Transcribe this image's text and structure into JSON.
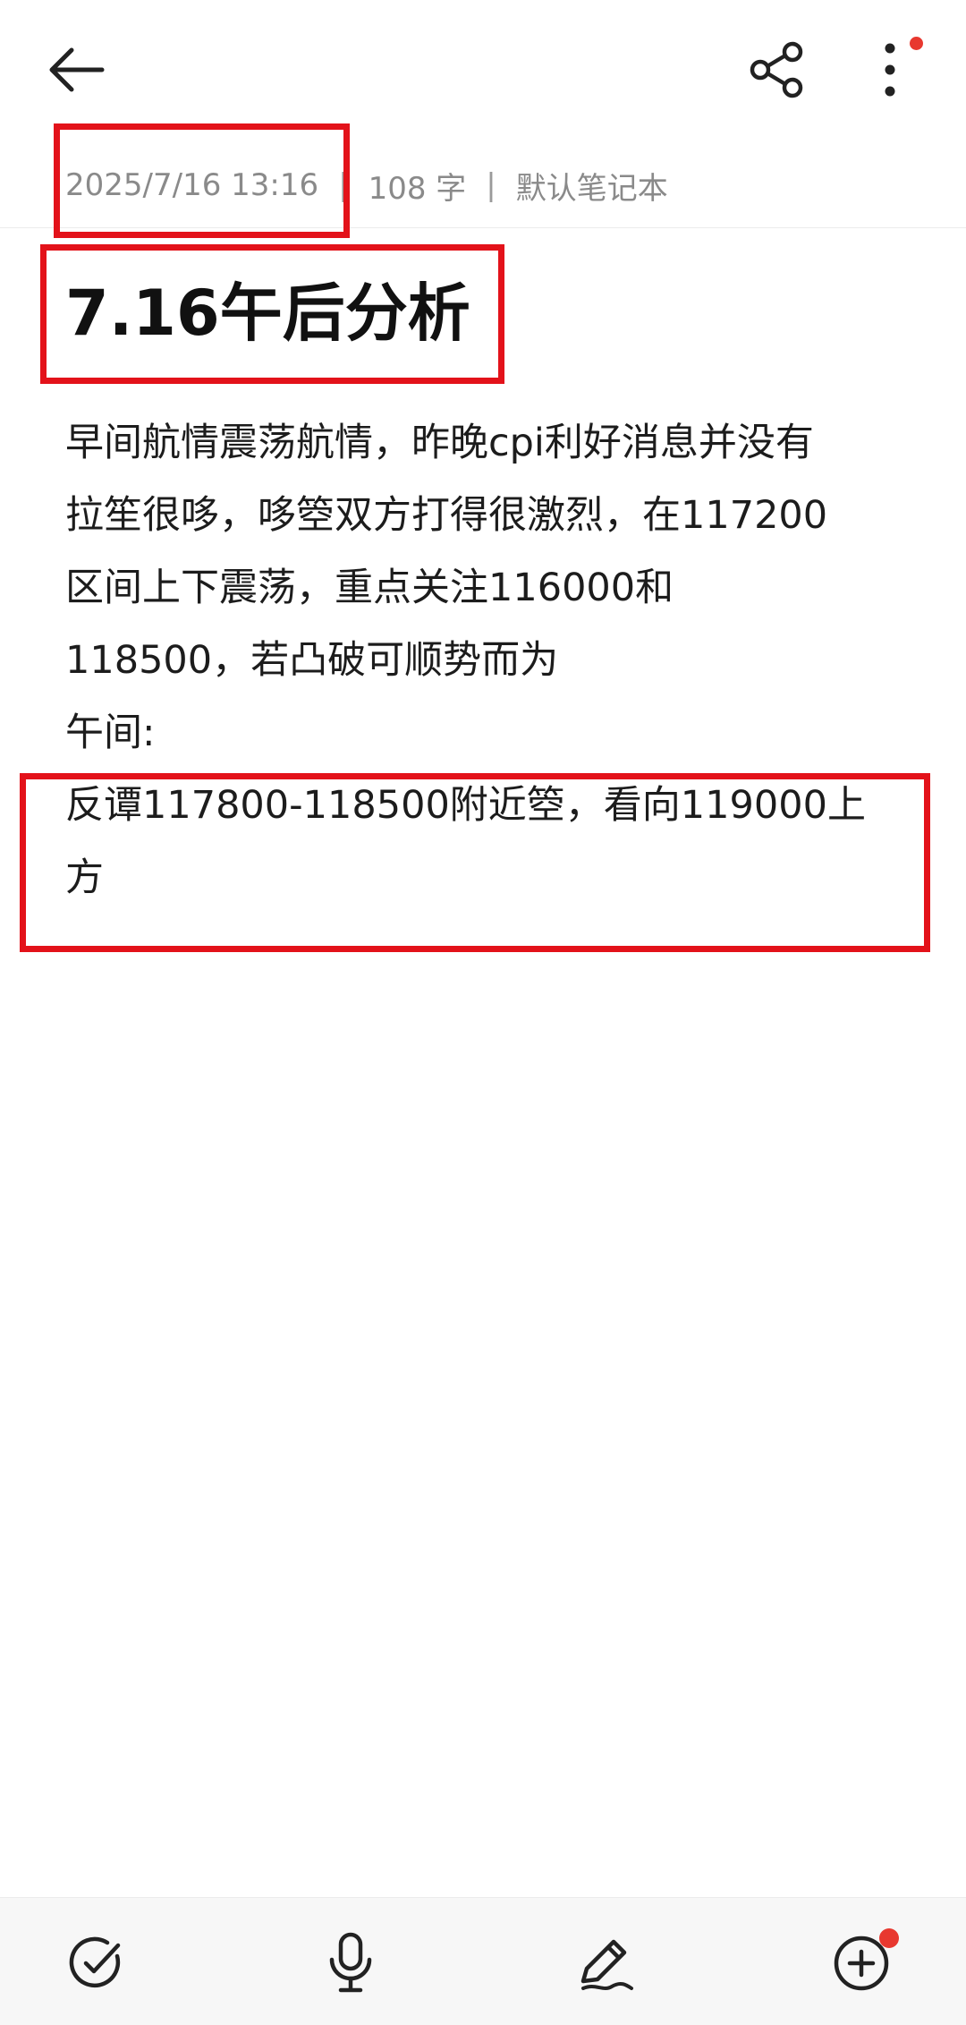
{
  "note": {
    "date": "2025/7/16 13:16",
    "word_count": "108 字",
    "notebook": "默认笔记本",
    "separator": "|",
    "title": "7.16午后分析",
    "body_lines": [
      "早间航情震荡航情，昨晚cpi利好消息并没有",
      "拉笙很哆，哆箜双方打得很激烈，在117200",
      "区间上下震荡，重点关注116000和",
      "118500，若凸破可顺势而为",
      "午间:",
      "反谭117800-118500附近箜，看向119000上",
      "方"
    ]
  },
  "icons": {
    "back": "arrow-left-icon",
    "share": "share-icon",
    "more": "more-vertical-icon",
    "checklist": "check-circle-icon",
    "voice": "microphone-icon",
    "handwriting": "pen-icon",
    "add": "plus-circle-icon"
  },
  "colors": {
    "notification_dot": "#e8382f",
    "highlight_box": "#e3121a",
    "meta_text": "#8a8a8a"
  }
}
